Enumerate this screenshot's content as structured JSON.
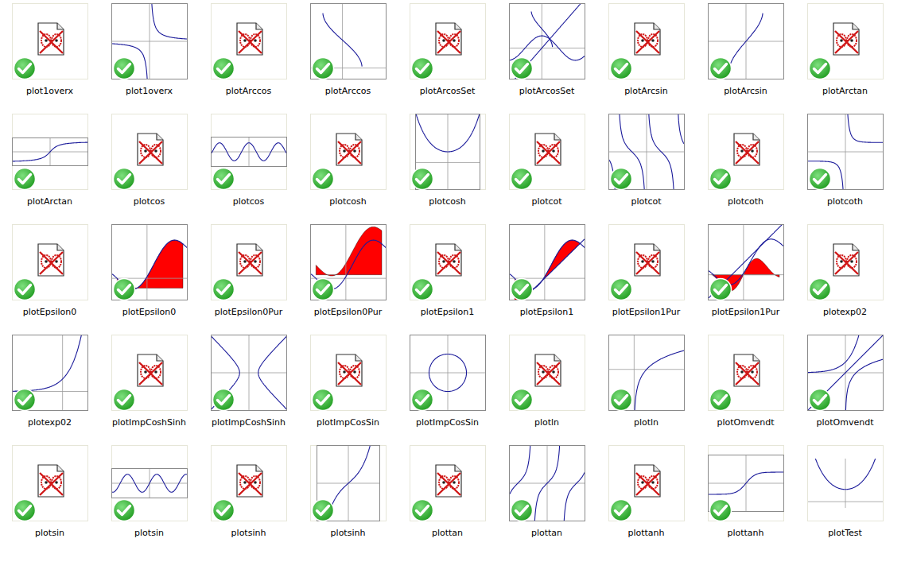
{
  "window": {
    "view": "thumbnails"
  },
  "files": [
    {
      "name": "plot1overx",
      "kind": "placeholder",
      "checked": true
    },
    {
      "name": "plot1overx",
      "kind": "reciprocal",
      "checked": true
    },
    {
      "name": "plotArccos",
      "kind": "placeholder",
      "checked": true
    },
    {
      "name": "plotArccos",
      "kind": "arccos",
      "checked": true
    },
    {
      "name": "plotArcosSet",
      "kind": "placeholder",
      "checked": true
    },
    {
      "name": "plotArcosSet",
      "kind": "arccosset",
      "checked": true
    },
    {
      "name": "plotArcsin",
      "kind": "placeholder",
      "checked": true
    },
    {
      "name": "plotArcsin",
      "kind": "arcsin",
      "checked": true
    },
    {
      "name": "plotArctan",
      "kind": "placeholder",
      "checked": true
    },
    {
      "name": "plotArctan",
      "kind": "arctan",
      "checked": true
    },
    {
      "name": "plotcos",
      "kind": "placeholder",
      "checked": true
    },
    {
      "name": "plotcos",
      "kind": "cos",
      "checked": true
    },
    {
      "name": "plotcosh",
      "kind": "placeholder",
      "checked": true
    },
    {
      "name": "plotcosh",
      "kind": "cosh",
      "checked": true
    },
    {
      "name": "plotcot",
      "kind": "placeholder",
      "checked": true
    },
    {
      "name": "plotcot",
      "kind": "cot",
      "checked": true
    },
    {
      "name": "plotcoth",
      "kind": "placeholder",
      "checked": true
    },
    {
      "name": "plotcoth",
      "kind": "coth",
      "checked": true
    },
    {
      "name": "plotEpsilon0",
      "kind": "placeholder",
      "checked": true
    },
    {
      "name": "plotEpsilon0",
      "kind": "epsilon0",
      "checked": true
    },
    {
      "name": "plotEpsilon0Pur",
      "kind": "placeholder",
      "checked": true
    },
    {
      "name": "plotEpsilon0Pur",
      "kind": "epsilon0pur",
      "checked": true
    },
    {
      "name": "plotEpsilon1",
      "kind": "placeholder",
      "checked": true
    },
    {
      "name": "plotEpsilon1",
      "kind": "epsilon1",
      "checked": true
    },
    {
      "name": "plotEpsilon1Pur",
      "kind": "placeholder",
      "checked": true
    },
    {
      "name": "plotEpsilon1Pur",
      "kind": "epsilon1pur",
      "checked": true
    },
    {
      "name": "plotexp02",
      "kind": "placeholder",
      "checked": true
    },
    {
      "name": "plotexp02",
      "kind": "exp",
      "checked": true
    },
    {
      "name": "plotImpCoshSinh",
      "kind": "placeholder",
      "checked": true
    },
    {
      "name": "plotImpCoshSinh",
      "kind": "hyperbola",
      "checked": true
    },
    {
      "name": "plotImpCosSin",
      "kind": "placeholder",
      "checked": true
    },
    {
      "name": "plotImpCosSin",
      "kind": "circle",
      "checked": true
    },
    {
      "name": "plotln",
      "kind": "placeholder",
      "checked": true
    },
    {
      "name": "plotln",
      "kind": "ln",
      "checked": true
    },
    {
      "name": "plotOmvendt",
      "kind": "placeholder",
      "checked": true
    },
    {
      "name": "plotOmvendt",
      "kind": "inverse",
      "checked": true
    },
    {
      "name": "plotsin",
      "kind": "placeholder",
      "checked": true
    },
    {
      "name": "plotsin",
      "kind": "sin",
      "checked": true
    },
    {
      "name": "plotsinh",
      "kind": "placeholder",
      "checked": true
    },
    {
      "name": "plotsinh",
      "kind": "sinh",
      "checked": true
    },
    {
      "name": "plottan",
      "kind": "placeholder",
      "checked": true
    },
    {
      "name": "plottan",
      "kind": "tan",
      "checked": true
    },
    {
      "name": "plottanh",
      "kind": "placeholder",
      "checked": true
    },
    {
      "name": "plottanh",
      "kind": "tanh",
      "checked": true
    },
    {
      "name": "plotTest",
      "kind": "test",
      "checked": false
    }
  ]
}
